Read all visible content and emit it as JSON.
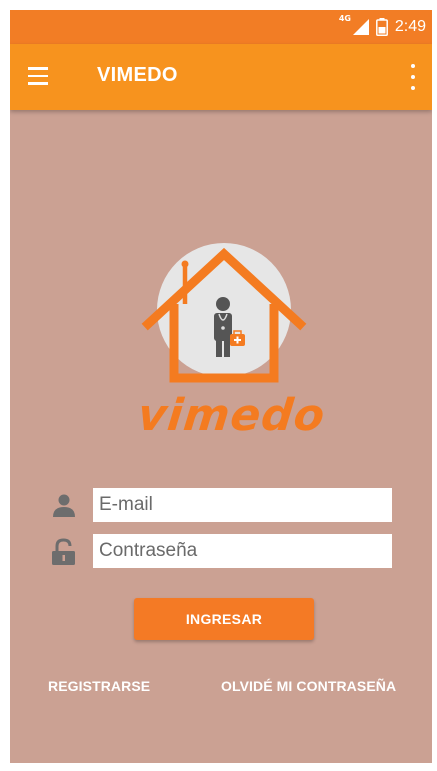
{
  "status_bar": {
    "network": "4G",
    "time": "2:49"
  },
  "app_bar": {
    "title": "VIMEDO",
    "menu_icon": "hamburger-menu-icon",
    "overflow_icon": "more-vert-icon"
  },
  "logo": {
    "brand": "vimedo",
    "icon": "house-doctor-logo"
  },
  "form": {
    "email_placeholder": "E-mail",
    "email_value": "",
    "email_icon": "person-icon",
    "password_placeholder": "Contraseña",
    "password_value": "",
    "password_icon": "unlock-icon",
    "submit_label": "INGRESAR"
  },
  "links": {
    "register": "REGISTRARSE",
    "forgot_password": "OLVIDÉ MI CONTRASEÑA"
  },
  "colors": {
    "status_bar": "#f27d25",
    "app_bar": "#f7931e",
    "background": "#cba193",
    "accent": "#f47a25"
  }
}
